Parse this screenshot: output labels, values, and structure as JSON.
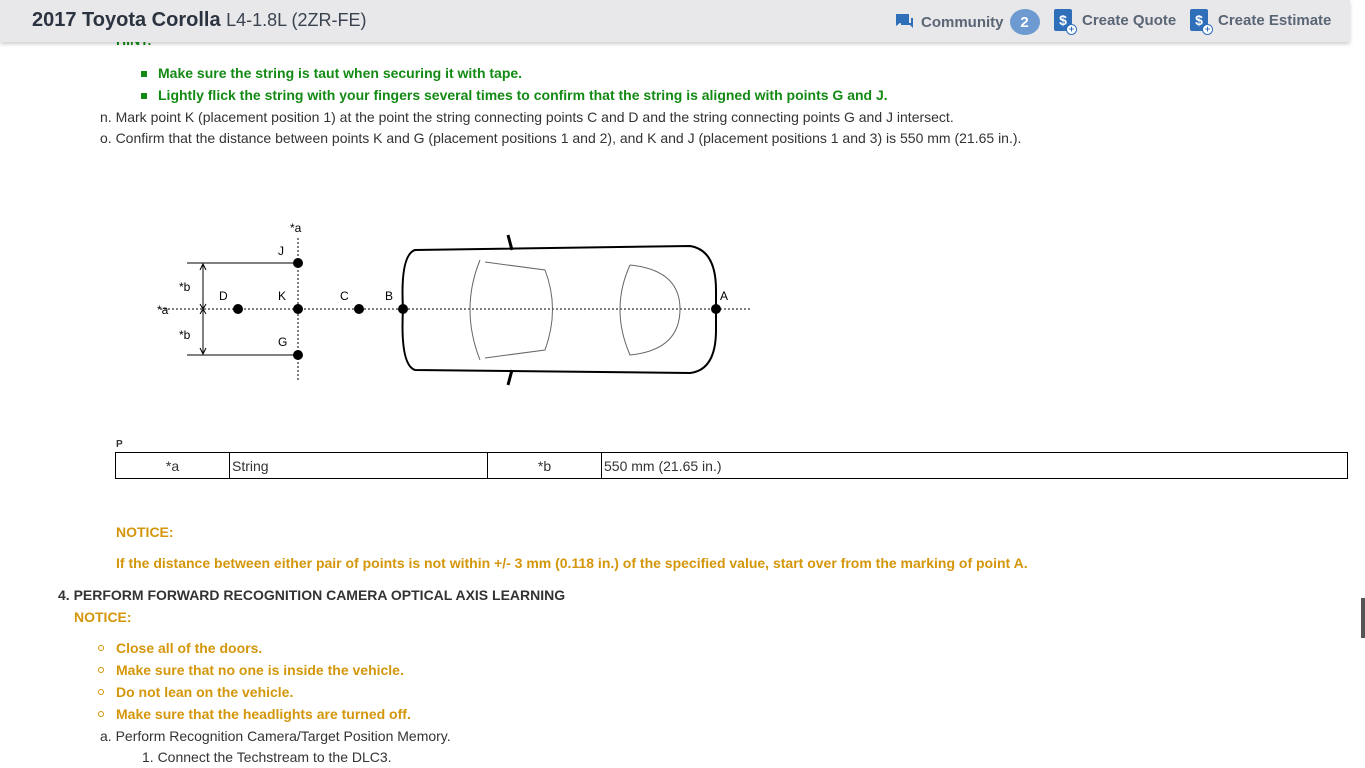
{
  "header": {
    "title": "2017 Toyota Corolla",
    "subtitle": "L4-1.8L (2ZR-FE)",
    "community": "Community",
    "community_count": "2",
    "create_quote": "Create Quote",
    "create_estimate": "Create Estimate"
  },
  "hint": {
    "label": "HINT:",
    "items": [
      "Make sure the string is taut when securing it with tape.",
      "Lightly flick the string with your fingers several times to confirm that the string is aligned with points G and J."
    ]
  },
  "steps": {
    "n": "n. Mark point K (placement position 1) at the point the string connecting points C and D and the string connecting points G and J intersect.",
    "o": "o. Confirm that the distance between points K and G (placement positions 1 and 2), and K and J (placement positions 1 and 3) is 550 mm (21.65 in.)."
  },
  "diagram": {
    "labels": {
      "a_top": "*a",
      "a_left": "*a",
      "b_top": "*b",
      "b_bottom": "*b",
      "J": "J",
      "K": "K",
      "G": "G",
      "D": "D",
      "C": "C",
      "B": "B",
      "A": "A"
    },
    "marker": "P"
  },
  "legend_table": {
    "row": [
      "*a",
      "String",
      "*b",
      "550 mm (21.65 in.)"
    ]
  },
  "notice1": {
    "label": "NOTICE:",
    "text": "If the distance between either pair of points is not within +/- 3 mm (0.118 in.) of the specified value, start over from the marking of point A."
  },
  "section4": {
    "title": "4. PERFORM FORWARD RECOGNITION CAMERA OPTICAL AXIS LEARNING",
    "notice_label": "NOTICE:",
    "notice_items": [
      "Close all of the doors.",
      "Make sure that no one is inside the vehicle.",
      "Do not lean on the vehicle.",
      "Make sure that the headlights are turned off."
    ],
    "step_a": "a. Perform Recognition Camera/Target Position Memory.",
    "step_1": "1. Connect the Techstream to the DLC3."
  },
  "colors": {
    "green": "#138a13",
    "orange": "#d4960a",
    "accent": "#2f6fba"
  }
}
